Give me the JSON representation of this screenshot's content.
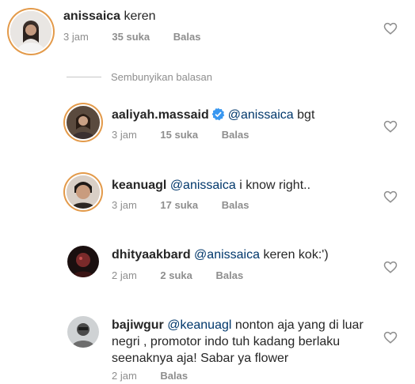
{
  "comments": [
    {
      "username": "anissaica",
      "text": "keren",
      "mention": "",
      "time": "3 jam",
      "likes": "35 suka",
      "reply": "Balas"
    },
    {
      "username": "aaliyah.massaid",
      "mention": "@anissaica",
      "text": "bgt",
      "time": "3 jam",
      "likes": "15 suka",
      "reply": "Balas"
    },
    {
      "username": "keanuagl",
      "mention": "@anissaica",
      "text": "i know right..",
      "time": "3 jam",
      "likes": "17 suka",
      "reply": "Balas"
    },
    {
      "username": "dhityaakbard",
      "mention": "@anissaica",
      "text": "keren kok:')",
      "time": "2 jam",
      "likes": "2 suka",
      "reply": "Balas"
    },
    {
      "username": "bajiwgur",
      "mention": "@keanuagl",
      "text": "nonton aja yang di luar negri , promotor indo tuh kadang berlaku seenaknya aja! Sabar ya flower",
      "time": "2 jam",
      "likes": "",
      "reply": "Balas"
    }
  ],
  "hide_replies_label": "Sembunyikan balasan",
  "colors": {
    "text": "#262626",
    "meta": "#8e8e8e",
    "mention": "#00376b",
    "verified": "#3897f0",
    "story_ring": "#e39a4a"
  }
}
